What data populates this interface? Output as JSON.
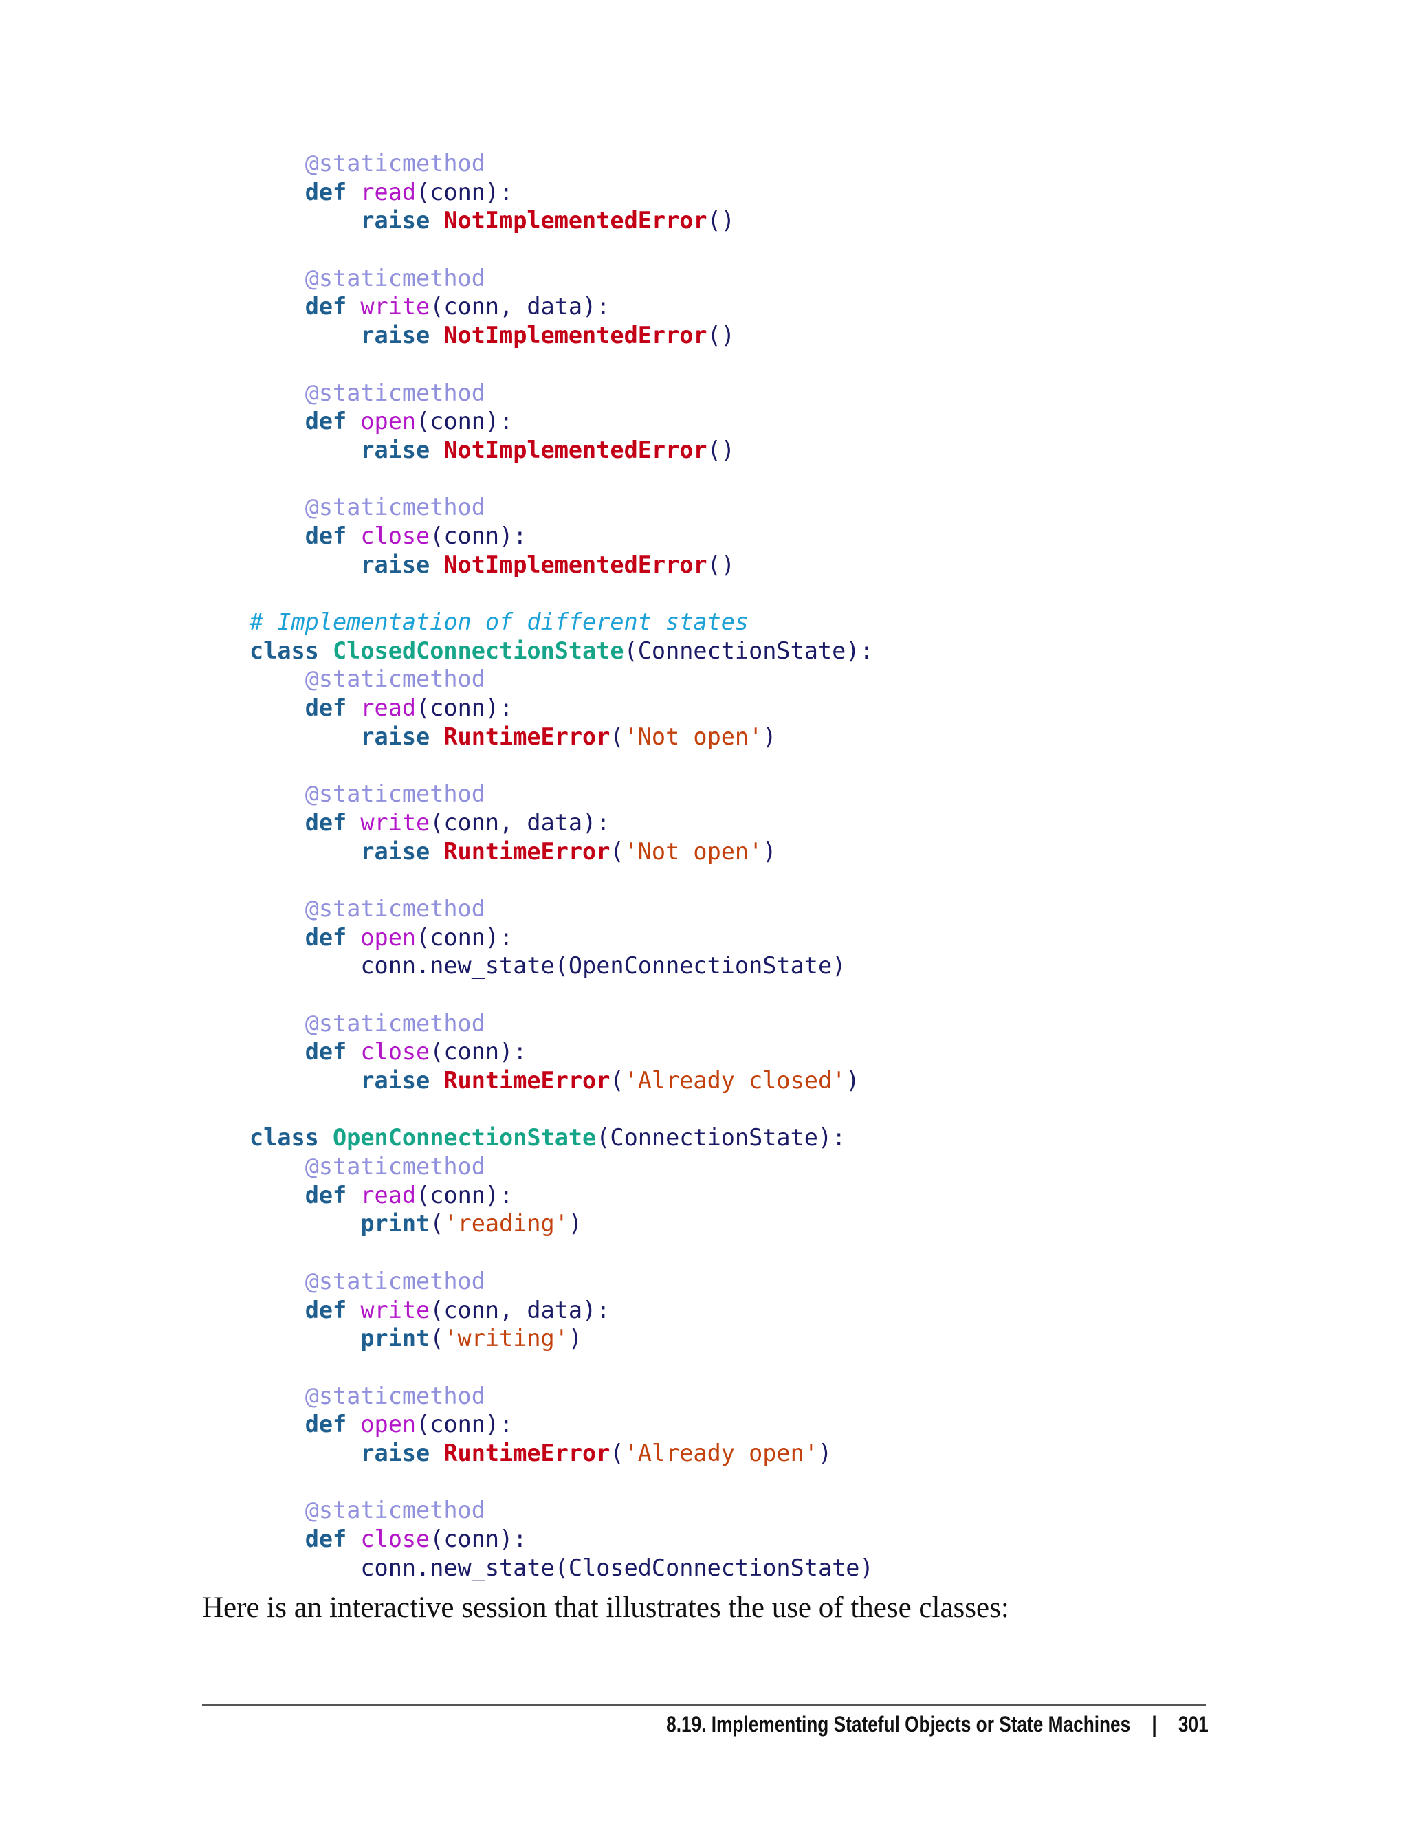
{
  "code_lines": [
    [
      [
        "    ",
        "ws"
      ],
      [
        "@staticmethod",
        "deco"
      ]
    ],
    [
      [
        "    ",
        "ws"
      ],
      [
        "def",
        "kw"
      ],
      [
        " ",
        "ws"
      ],
      [
        "read",
        "fn"
      ],
      [
        "(",
        "p"
      ],
      [
        "conn",
        "id"
      ],
      [
        "):",
        "p"
      ]
    ],
    [
      [
        "        ",
        "ws"
      ],
      [
        "raise",
        "kw"
      ],
      [
        " ",
        "ws"
      ],
      [
        "NotImplementedError",
        "exc"
      ],
      [
        "()",
        "p"
      ]
    ],
    [],
    [
      [
        "    ",
        "ws"
      ],
      [
        "@staticmethod",
        "deco"
      ]
    ],
    [
      [
        "    ",
        "ws"
      ],
      [
        "def",
        "kw"
      ],
      [
        " ",
        "ws"
      ],
      [
        "write",
        "fn"
      ],
      [
        "(",
        "p"
      ],
      [
        "conn",
        "id"
      ],
      [
        ", ",
        "p"
      ],
      [
        "data",
        "id"
      ],
      [
        "):",
        "p"
      ]
    ],
    [
      [
        "        ",
        "ws"
      ],
      [
        "raise",
        "kw"
      ],
      [
        " ",
        "ws"
      ],
      [
        "NotImplementedError",
        "exc"
      ],
      [
        "()",
        "p"
      ]
    ],
    [],
    [
      [
        "    ",
        "ws"
      ],
      [
        "@staticmethod",
        "deco"
      ]
    ],
    [
      [
        "    ",
        "ws"
      ],
      [
        "def",
        "kw"
      ],
      [
        " ",
        "ws"
      ],
      [
        "open",
        "fn"
      ],
      [
        "(",
        "p"
      ],
      [
        "conn",
        "id"
      ],
      [
        "):",
        "p"
      ]
    ],
    [
      [
        "        ",
        "ws"
      ],
      [
        "raise",
        "kw"
      ],
      [
        " ",
        "ws"
      ],
      [
        "NotImplementedError",
        "exc"
      ],
      [
        "()",
        "p"
      ]
    ],
    [],
    [
      [
        "    ",
        "ws"
      ],
      [
        "@staticmethod",
        "deco"
      ]
    ],
    [
      [
        "    ",
        "ws"
      ],
      [
        "def",
        "kw"
      ],
      [
        " ",
        "ws"
      ],
      [
        "close",
        "fn"
      ],
      [
        "(",
        "p"
      ],
      [
        "conn",
        "id"
      ],
      [
        "):",
        "p"
      ]
    ],
    [
      [
        "        ",
        "ws"
      ],
      [
        "raise",
        "kw"
      ],
      [
        " ",
        "ws"
      ],
      [
        "NotImplementedError",
        "exc"
      ],
      [
        "()",
        "p"
      ]
    ],
    [],
    [
      [
        "# Implementation of different states",
        "cmt"
      ]
    ],
    [
      [
        "class",
        "kw"
      ],
      [
        " ",
        "ws"
      ],
      [
        "ClosedConnectionState",
        "cls"
      ],
      [
        "(",
        "p"
      ],
      [
        "ConnectionState",
        "id"
      ],
      [
        "):",
        "p"
      ]
    ],
    [
      [
        "    ",
        "ws"
      ],
      [
        "@staticmethod",
        "deco"
      ]
    ],
    [
      [
        "    ",
        "ws"
      ],
      [
        "def",
        "kw"
      ],
      [
        " ",
        "ws"
      ],
      [
        "read",
        "fn"
      ],
      [
        "(",
        "p"
      ],
      [
        "conn",
        "id"
      ],
      [
        "):",
        "p"
      ]
    ],
    [
      [
        "        ",
        "ws"
      ],
      [
        "raise",
        "kw"
      ],
      [
        " ",
        "ws"
      ],
      [
        "RuntimeError",
        "exc"
      ],
      [
        "(",
        "p"
      ],
      [
        "'Not open'",
        "str"
      ],
      [
        ")",
        "p"
      ]
    ],
    [],
    [
      [
        "    ",
        "ws"
      ],
      [
        "@staticmethod",
        "deco"
      ]
    ],
    [
      [
        "    ",
        "ws"
      ],
      [
        "def",
        "kw"
      ],
      [
        " ",
        "ws"
      ],
      [
        "write",
        "fn"
      ],
      [
        "(",
        "p"
      ],
      [
        "conn",
        "id"
      ],
      [
        ", ",
        "p"
      ],
      [
        "data",
        "id"
      ],
      [
        "):",
        "p"
      ]
    ],
    [
      [
        "        ",
        "ws"
      ],
      [
        "raise",
        "kw"
      ],
      [
        " ",
        "ws"
      ],
      [
        "RuntimeError",
        "exc"
      ],
      [
        "(",
        "p"
      ],
      [
        "'Not open'",
        "str"
      ],
      [
        ")",
        "p"
      ]
    ],
    [],
    [
      [
        "    ",
        "ws"
      ],
      [
        "@staticmethod",
        "deco"
      ]
    ],
    [
      [
        "    ",
        "ws"
      ],
      [
        "def",
        "kw"
      ],
      [
        " ",
        "ws"
      ],
      [
        "open",
        "fn"
      ],
      [
        "(",
        "p"
      ],
      [
        "conn",
        "id"
      ],
      [
        "):",
        "p"
      ]
    ],
    [
      [
        "        ",
        "ws"
      ],
      [
        "conn.new_state",
        "id"
      ],
      [
        "(",
        "p"
      ],
      [
        "OpenConnectionState",
        "id"
      ],
      [
        ")",
        "p"
      ]
    ],
    [],
    [
      [
        "    ",
        "ws"
      ],
      [
        "@staticmethod",
        "deco"
      ]
    ],
    [
      [
        "    ",
        "ws"
      ],
      [
        "def",
        "kw"
      ],
      [
        " ",
        "ws"
      ],
      [
        "close",
        "fn"
      ],
      [
        "(",
        "p"
      ],
      [
        "conn",
        "id"
      ],
      [
        "):",
        "p"
      ]
    ],
    [
      [
        "        ",
        "ws"
      ],
      [
        "raise",
        "kw"
      ],
      [
        " ",
        "ws"
      ],
      [
        "RuntimeError",
        "exc"
      ],
      [
        "(",
        "p"
      ],
      [
        "'Already closed'",
        "str"
      ],
      [
        ")",
        "p"
      ]
    ],
    [],
    [
      [
        "class",
        "kw"
      ],
      [
        " ",
        "ws"
      ],
      [
        "OpenConnectionState",
        "cls"
      ],
      [
        "(",
        "p"
      ],
      [
        "ConnectionState",
        "id"
      ],
      [
        "):",
        "p"
      ]
    ],
    [
      [
        "    ",
        "ws"
      ],
      [
        "@staticmethod",
        "deco"
      ]
    ],
    [
      [
        "    ",
        "ws"
      ],
      [
        "def",
        "kw"
      ],
      [
        " ",
        "ws"
      ],
      [
        "read",
        "fn"
      ],
      [
        "(",
        "p"
      ],
      [
        "conn",
        "id"
      ],
      [
        "):",
        "p"
      ]
    ],
    [
      [
        "        ",
        "ws"
      ],
      [
        "print",
        "kw"
      ],
      [
        "(",
        "p"
      ],
      [
        "'reading'",
        "str"
      ],
      [
        ")",
        "p"
      ]
    ],
    [],
    [
      [
        "    ",
        "ws"
      ],
      [
        "@staticmethod",
        "deco"
      ]
    ],
    [
      [
        "    ",
        "ws"
      ],
      [
        "def",
        "kw"
      ],
      [
        " ",
        "ws"
      ],
      [
        "write",
        "fn"
      ],
      [
        "(",
        "p"
      ],
      [
        "conn",
        "id"
      ],
      [
        ", ",
        "p"
      ],
      [
        "data",
        "id"
      ],
      [
        "):",
        "p"
      ]
    ],
    [
      [
        "        ",
        "ws"
      ],
      [
        "print",
        "kw"
      ],
      [
        "(",
        "p"
      ],
      [
        "'writing'",
        "str"
      ],
      [
        ")",
        "p"
      ]
    ],
    [],
    [
      [
        "    ",
        "ws"
      ],
      [
        "@staticmethod",
        "deco"
      ]
    ],
    [
      [
        "    ",
        "ws"
      ],
      [
        "def",
        "kw"
      ],
      [
        " ",
        "ws"
      ],
      [
        "open",
        "fn"
      ],
      [
        "(",
        "p"
      ],
      [
        "conn",
        "id"
      ],
      [
        "):",
        "p"
      ]
    ],
    [
      [
        "        ",
        "ws"
      ],
      [
        "raise",
        "kw"
      ],
      [
        " ",
        "ws"
      ],
      [
        "RuntimeError",
        "exc"
      ],
      [
        "(",
        "p"
      ],
      [
        "'Already open'",
        "str"
      ],
      [
        ")",
        "p"
      ]
    ],
    [],
    [
      [
        "    ",
        "ws"
      ],
      [
        "@staticmethod",
        "deco"
      ]
    ],
    [
      [
        "    ",
        "ws"
      ],
      [
        "def",
        "kw"
      ],
      [
        " ",
        "ws"
      ],
      [
        "close",
        "fn"
      ],
      [
        "(",
        "p"
      ],
      [
        "conn",
        "id"
      ],
      [
        "):",
        "p"
      ]
    ],
    [
      [
        "        ",
        "ws"
      ],
      [
        "conn.new_state",
        "id"
      ],
      [
        "(",
        "p"
      ],
      [
        "ClosedConnectionState",
        "id"
      ],
      [
        ")",
        "p"
      ]
    ]
  ],
  "prose": "Here is an interactive session that illustrates the use of these classes:",
  "footer": {
    "section_title": "8.19. Implementing Stateful Objects or State Machines",
    "separator": "|",
    "page_number": "301"
  },
  "colors": {
    "keyword": "#1f5f8f",
    "function_name": "#b315c9",
    "decorator": "#9090dc",
    "exception": "#c40017",
    "class_name": "#17a589",
    "string": "#c2410c",
    "comment": "#1ba1d6",
    "identifier": "#1a1a66"
  }
}
